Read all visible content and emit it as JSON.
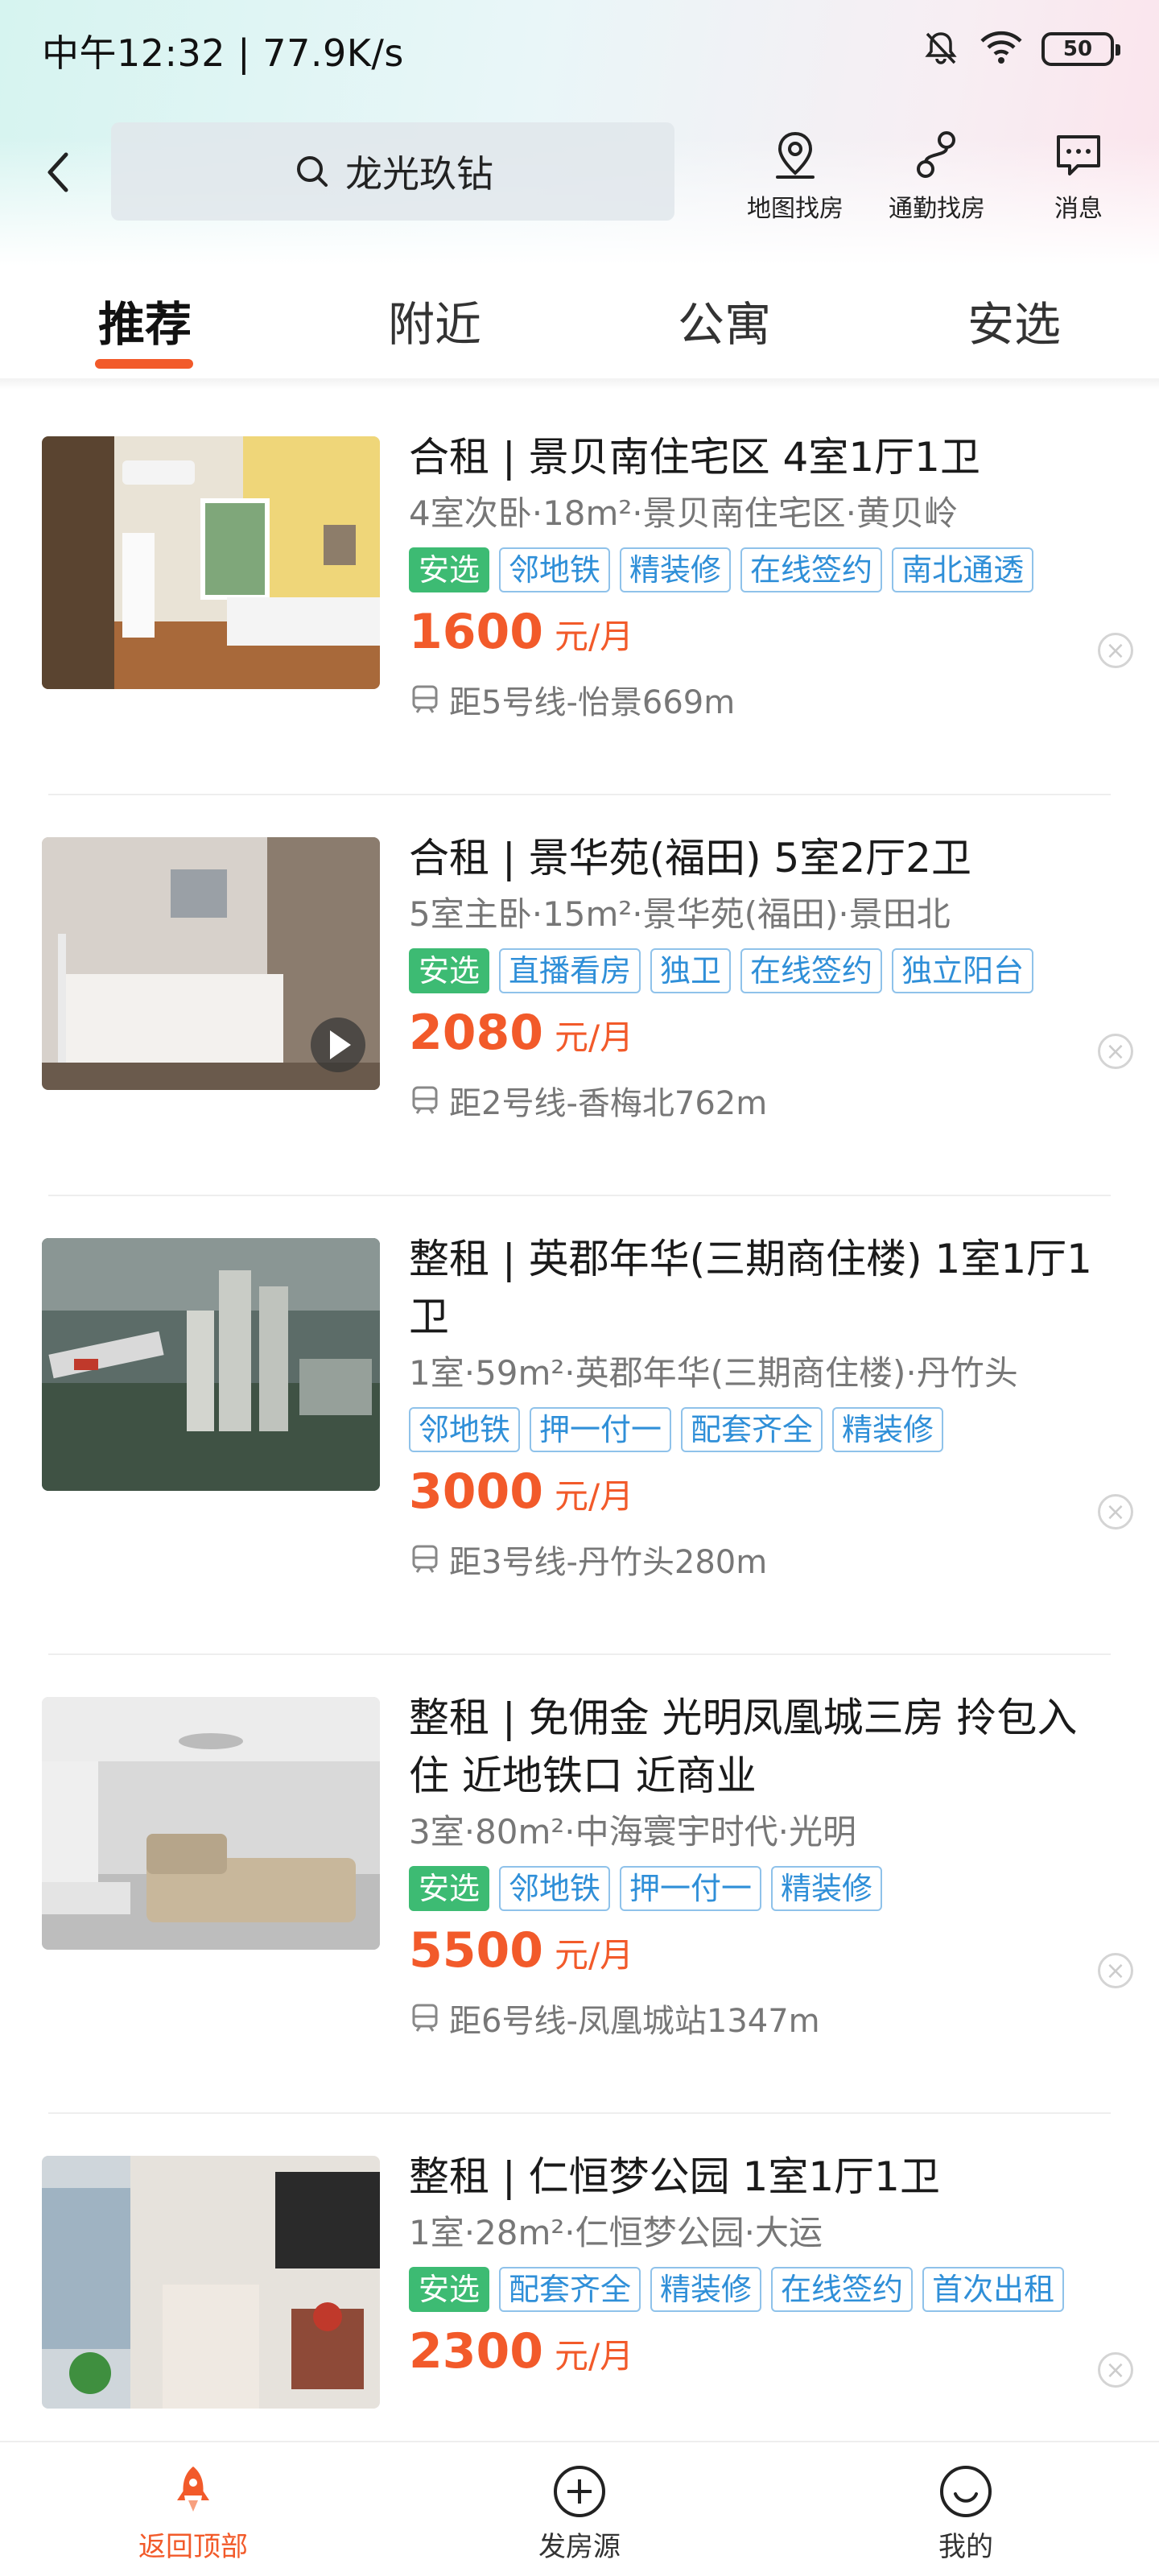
{
  "status_bar": {
    "time": "中午12:32 | 77.9K/s",
    "battery": "50"
  },
  "header": {
    "search_text": "龙光玖钻",
    "actions": [
      {
        "label": "地图找房",
        "icon": "map-pin-icon"
      },
      {
        "label": "通勤找房",
        "icon": "route-icon"
      },
      {
        "label": "消息",
        "icon": "message-icon"
      }
    ]
  },
  "tabs": [
    {
      "label": "推荐",
      "active": true
    },
    {
      "label": "附近",
      "active": false
    },
    {
      "label": "公寓",
      "active": false
    },
    {
      "label": "安选",
      "active": false
    }
  ],
  "listings": [
    {
      "title": "合租 | 景贝南住宅区 4室1厅1卫",
      "subtitle": "4室次卧·18m²·景贝南住宅区·黄贝岭",
      "tags": [
        "安选",
        "邻地铁",
        "精装修",
        "在线签约",
        "南北通透"
      ],
      "price": "1600",
      "unit": "元/月",
      "metro": "距5号线-怡景669m"
    },
    {
      "title": "合租 | 景华苑(福田) 5室2厅2卫",
      "subtitle": "5室主卧·15m²·景华苑(福田)·景田北",
      "tags": [
        "安选",
        "直播看房",
        "独卫",
        "在线签约",
        "独立阳台"
      ],
      "price": "2080",
      "unit": "元/月",
      "metro": "距2号线-香梅北762m"
    },
    {
      "title": "整租 | 英郡年华(三期商住楼) 1室1厅1卫",
      "subtitle": "1室·59m²·英郡年华(三期商住楼)·丹竹头",
      "tags": [
        "邻地铁",
        "押一付一",
        "配套齐全",
        "精装修"
      ],
      "price": "3000",
      "unit": "元/月",
      "metro": "距3号线-丹竹头280m"
    },
    {
      "title": "整租 | 免佣金 光明凤凰城三房 拎包入住 近地铁口 近商业",
      "subtitle": "3室·80m²·中海寰宇时代·光明",
      "tags": [
        "安选",
        "邻地铁",
        "押一付一",
        "精装修"
      ],
      "price": "5500",
      "unit": "元/月",
      "metro": "距6号线-凤凰城站1347m"
    },
    {
      "title": "整租 | 仁恒梦公园 1室1厅1卫",
      "subtitle": "1室·28m²·仁恒梦公园·大运",
      "tags": [
        "安选",
        "配套齐全",
        "精装修",
        "在线签约",
        "首次出租"
      ],
      "price": "2300",
      "unit": "元/月",
      "metro": ""
    }
  ],
  "bottom_nav": [
    {
      "label": "返回顶部",
      "active": true
    },
    {
      "label": "发房源",
      "active": false
    },
    {
      "label": "我的",
      "active": false
    }
  ],
  "colors": {
    "accent": "#f25a2a",
    "tag_blue": "#2f8fd8",
    "select_green": "#3dbb73"
  }
}
